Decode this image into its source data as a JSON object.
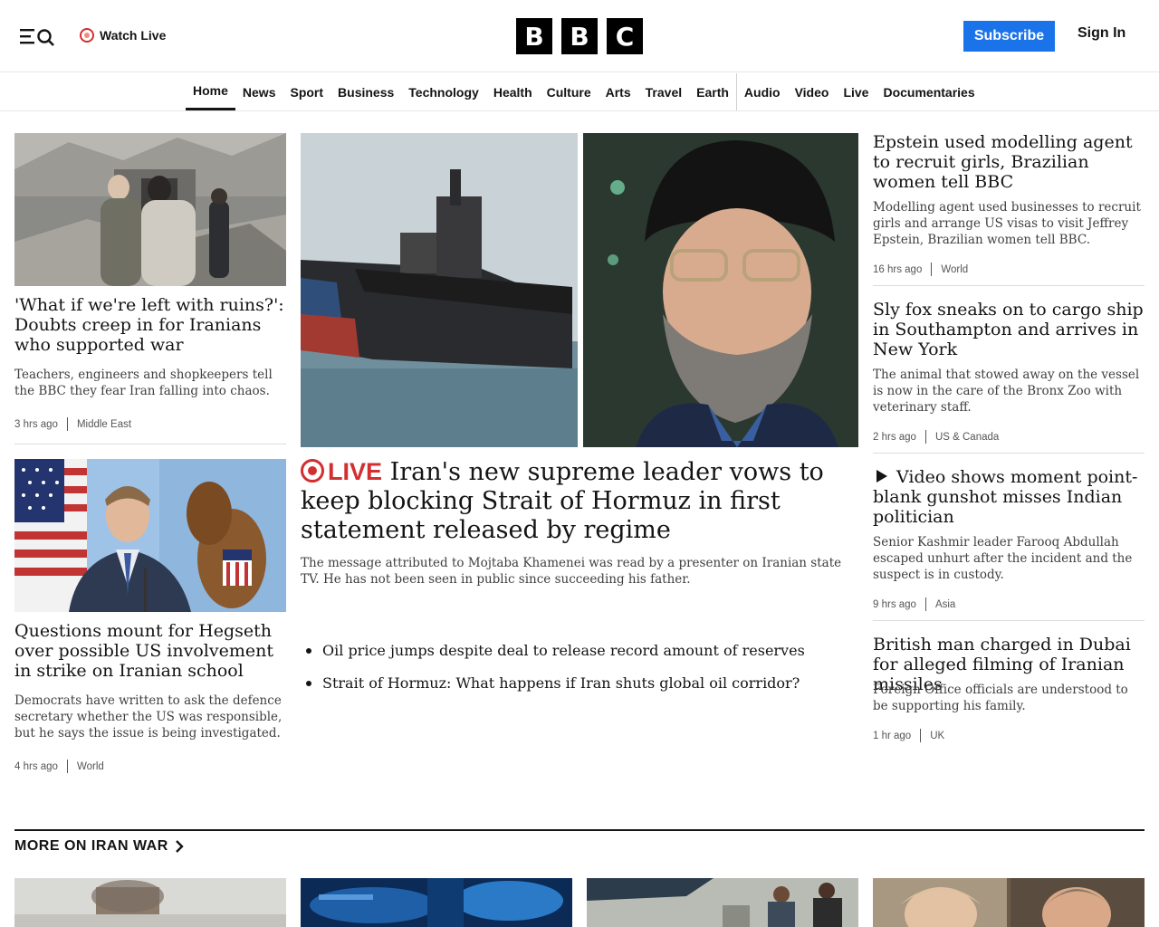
{
  "header": {
    "watch_live": "Watch Live",
    "logo_letters": [
      "B",
      "B",
      "C"
    ],
    "subscribe": "Subscribe",
    "sign_in": "Sign In"
  },
  "nav": {
    "items": [
      "Home",
      "News",
      "Sport",
      "Business",
      "Technology",
      "Health",
      "Culture",
      "Arts",
      "Travel",
      "Earth",
      "Audio",
      "Video",
      "Live",
      "Documentaries"
    ],
    "active": "Home"
  },
  "left": {
    "story1": {
      "headline": "'What if we're left with ruins?': Doubts creep in for Iranians who supported war",
      "summary": "Teachers, engineers and shopkeepers tell the BBC they fear Iran falling into chaos.",
      "time": "3 hrs ago",
      "section": "Middle East"
    },
    "story2": {
      "headline": "Questions mount for Hegseth over possible US involvement in strike on Iranian school",
      "summary": "Democrats have written to ask the defence secretary whether the US was responsible, but he says the issue is being investigated.",
      "time": "4 hrs ago",
      "section": "World"
    }
  },
  "lead": {
    "live_label": "LIVE",
    "headline": "Iran's new supreme leader vows to keep blocking Strait of Hormuz in first statement released by regime",
    "summary": "The message attributed to Mojtaba Khamenei was read by a presenter on Iranian state TV. He has not been seen in public since succeeding his father.",
    "related": [
      "Oil price jumps despite deal to release record amount of reserves",
      "Strait of Hormuz: What happens if Iran shuts global oil corridor?"
    ]
  },
  "right": {
    "story1": {
      "headline": "Epstein used modelling agent to recruit girls, Brazilian women tell BBC",
      "summary": "Modelling agent used businesses to recruit girls and arrange US visas to visit Jeffrey Epstein, Brazilian women tell BBC.",
      "time": "16 hrs ago",
      "section": "World"
    },
    "story2": {
      "headline": "Sly fox sneaks on to cargo ship in Southampton and arrives in New York",
      "summary": "The animal that stowed away on the vessel is now in the care of the Bronx Zoo with veterinary staff.",
      "time": "2 hrs ago",
      "section": "US & Canada"
    },
    "story3": {
      "headline": "Video shows moment point-blank gunshot misses Indian politician",
      "summary": "Senior Kashmir leader Farooq Abdullah escaped unhurt after the incident and the suspect is in custody.",
      "time": "9 hrs ago",
      "section": "Asia"
    },
    "story4": {
      "headline": "British man charged in Dubai for alleged filming of Iranian missiles",
      "summary": "Foreign Office officials are understood to be supporting his family.",
      "time": "1 hr ago",
      "section": "UK"
    }
  },
  "more": {
    "title": "MORE ON IRAN WAR"
  },
  "colors": {
    "accent_blue": "#1a73e8",
    "live_red": "#d32f2f"
  }
}
